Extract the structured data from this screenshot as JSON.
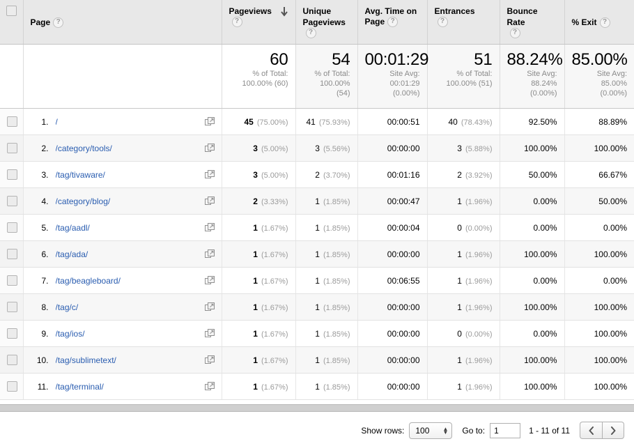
{
  "table": {
    "columns": [
      {
        "id": "checkbox",
        "label": "",
        "icon": "checkbox"
      },
      {
        "id": "page",
        "label": "Page",
        "help": "?"
      },
      {
        "id": "pageviews",
        "label": "Pageviews",
        "help": "?",
        "sorted": "desc",
        "sort_icon": "arrow-down"
      },
      {
        "id": "unique_pageviews",
        "label_line1": "Unique",
        "label_line2": "Pageviews",
        "help": "?"
      },
      {
        "id": "avg_time_on_page",
        "label_line1": "Avg. Time on",
        "label_line2": "Page",
        "help": "?"
      },
      {
        "id": "entrances",
        "label": "Entrances",
        "help": "?"
      },
      {
        "id": "bounce_rate",
        "label": "Bounce Rate",
        "help": "?"
      },
      {
        "id": "exit_rate",
        "label": "% Exit",
        "help": "?"
      }
    ],
    "summary": {
      "pageviews": {
        "value": "60",
        "l1": "% of Total:",
        "l2": "100.00% (60)"
      },
      "unique_pageviews": {
        "value": "54",
        "l1": "% of Total:",
        "l2": "100.00%",
        "l3": "(54)"
      },
      "avg_time_on_page": {
        "value": "00:01:29",
        "l1": "Site Avg:",
        "l2": "00:01:29",
        "l3": "(0.00%)"
      },
      "entrances": {
        "value": "51",
        "l1": "% of Total:",
        "l2": "100.00% (51)"
      },
      "bounce_rate": {
        "value": "88.24%",
        "l1": "Site Avg:",
        "l2": "88.24%",
        "l3": "(0.00%)"
      },
      "exit_rate": {
        "value": "85.00%",
        "l1": "Site Avg:",
        "l2": "85.00%",
        "l3": "(0.00%)"
      }
    },
    "rows": [
      {
        "num": "1.",
        "page": "/",
        "pageviews": "45",
        "pageviews_pct": "(75.00%)",
        "unique": "41",
        "unique_pct": "(75.93%)",
        "time": "00:00:51",
        "entrances": "40",
        "entrances_pct": "(78.43%)",
        "bounce": "92.50%",
        "exit": "88.89%"
      },
      {
        "num": "2.",
        "page": "/category/tools/",
        "pageviews": "3",
        "pageviews_pct": "(5.00%)",
        "unique": "3",
        "unique_pct": "(5.56%)",
        "time": "00:00:00",
        "entrances": "3",
        "entrances_pct": "(5.88%)",
        "bounce": "100.00%",
        "exit": "100.00%"
      },
      {
        "num": "3.",
        "page": "/tag/tivaware/",
        "pageviews": "3",
        "pageviews_pct": "(5.00%)",
        "unique": "2",
        "unique_pct": "(3.70%)",
        "time": "00:01:16",
        "entrances": "2",
        "entrances_pct": "(3.92%)",
        "bounce": "50.00%",
        "exit": "66.67%"
      },
      {
        "num": "4.",
        "page": "/category/blog/",
        "pageviews": "2",
        "pageviews_pct": "(3.33%)",
        "unique": "1",
        "unique_pct": "(1.85%)",
        "time": "00:00:47",
        "entrances": "1",
        "entrances_pct": "(1.96%)",
        "bounce": "0.00%",
        "exit": "50.00%"
      },
      {
        "num": "5.",
        "page": "/tag/aadl/",
        "pageviews": "1",
        "pageviews_pct": "(1.67%)",
        "unique": "1",
        "unique_pct": "(1.85%)",
        "time": "00:00:04",
        "entrances": "0",
        "entrances_pct": "(0.00%)",
        "bounce": "0.00%",
        "exit": "0.00%"
      },
      {
        "num": "6.",
        "page": "/tag/ada/",
        "pageviews": "1",
        "pageviews_pct": "(1.67%)",
        "unique": "1",
        "unique_pct": "(1.85%)",
        "time": "00:00:00",
        "entrances": "1",
        "entrances_pct": "(1.96%)",
        "bounce": "100.00%",
        "exit": "100.00%"
      },
      {
        "num": "7.",
        "page": "/tag/beagleboard/",
        "pageviews": "1",
        "pageviews_pct": "(1.67%)",
        "unique": "1",
        "unique_pct": "(1.85%)",
        "time": "00:06:55",
        "entrances": "1",
        "entrances_pct": "(1.96%)",
        "bounce": "0.00%",
        "exit": "0.00%"
      },
      {
        "num": "8.",
        "page": "/tag/c/",
        "pageviews": "1",
        "pageviews_pct": "(1.67%)",
        "unique": "1",
        "unique_pct": "(1.85%)",
        "time": "00:00:00",
        "entrances": "1",
        "entrances_pct": "(1.96%)",
        "bounce": "100.00%",
        "exit": "100.00%"
      },
      {
        "num": "9.",
        "page": "/tag/ios/",
        "pageviews": "1",
        "pageviews_pct": "(1.67%)",
        "unique": "1",
        "unique_pct": "(1.85%)",
        "time": "00:00:00",
        "entrances": "0",
        "entrances_pct": "(0.00%)",
        "bounce": "0.00%",
        "exit": "100.00%"
      },
      {
        "num": "10.",
        "page": "/tag/sublimetext/",
        "pageviews": "1",
        "pageviews_pct": "(1.67%)",
        "unique": "1",
        "unique_pct": "(1.85%)",
        "time": "00:00:00",
        "entrances": "1",
        "entrances_pct": "(1.96%)",
        "bounce": "100.00%",
        "exit": "100.00%"
      },
      {
        "num": "11.",
        "page": "/tag/terminal/",
        "pageviews": "1",
        "pageviews_pct": "(1.67%)",
        "unique": "1",
        "unique_pct": "(1.85%)",
        "time": "00:00:00",
        "entrances": "1",
        "entrances_pct": "(1.96%)",
        "bounce": "100.00%",
        "exit": "100.00%"
      }
    ]
  },
  "footer": {
    "show_rows_label": "Show rows:",
    "rows_per_page": "100",
    "goto_label": "Go to:",
    "goto_value": "1",
    "range_text": "1 - 11 of 11",
    "prev_icon": "chevron-left",
    "next_icon": "chevron-right"
  },
  "colors": {
    "link": "#2a5db0",
    "header_bg": "#e8e8e8",
    "row_alt_bg": "#f7f7f7",
    "muted_text": "#9b9b9b"
  }
}
